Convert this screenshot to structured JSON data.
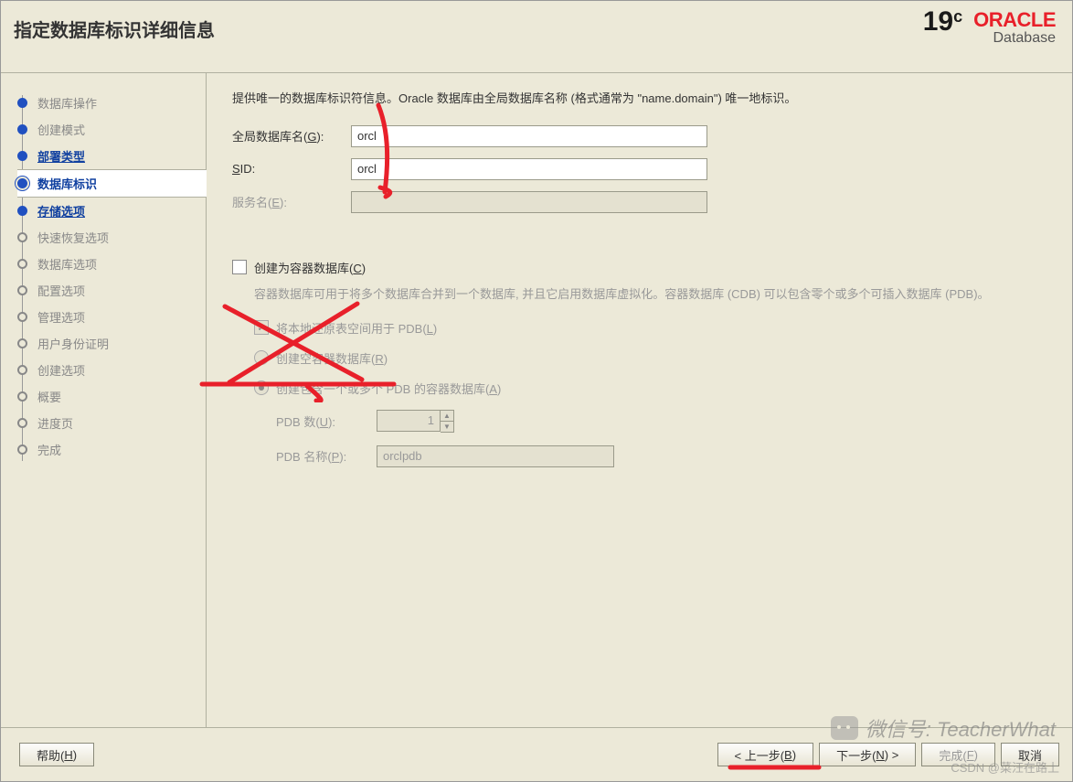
{
  "header": {
    "title": "指定数据库标识详细信息",
    "logo_version": "19",
    "logo_version_sup": "c",
    "logo_brand": "ORACLE",
    "logo_sub": "Database"
  },
  "sidebar": {
    "steps": [
      {
        "label": "数据库操作",
        "state": "done"
      },
      {
        "label": "创建模式",
        "state": "done"
      },
      {
        "label": "部署类型",
        "state": "link"
      },
      {
        "label": "数据库标识",
        "state": "active"
      },
      {
        "label": "存储选项",
        "state": "link"
      },
      {
        "label": "快速恢复选项",
        "state": "future"
      },
      {
        "label": "数据库选项",
        "state": "future"
      },
      {
        "label": "配置选项",
        "state": "future"
      },
      {
        "label": "管理选项",
        "state": "future"
      },
      {
        "label": "用户身份证明",
        "state": "future"
      },
      {
        "label": "创建选项",
        "state": "future"
      },
      {
        "label": "概要",
        "state": "future"
      },
      {
        "label": "进度页",
        "state": "future"
      },
      {
        "label": "完成",
        "state": "future"
      }
    ]
  },
  "content": {
    "intro": "提供唯一的数据库标识符信息。Oracle 数据库由全局数据库名称 (格式通常为 \"name.domain\") 唯一地标识。",
    "global_db_label_pre": "全局数据库名(",
    "global_db_key": "G",
    "global_db_label_post": "):",
    "global_db_value": "orcl",
    "sid_key": "S",
    "sid_label_post": "ID:",
    "sid_value": "orcl",
    "service_label_pre": "服务名(",
    "service_key": "E",
    "service_label_post": "):",
    "service_value": "",
    "cdb_check_pre": "创建为容器数据库(",
    "cdb_check_key": "C",
    "cdb_check_post": ")",
    "cdb_desc": "容器数据库可用于将多个数据库合并到一个数据库, 并且它启用数据库虚拟化。容器数据库 (CDB) 可以包含零个或多个可插入数据库 (PDB)。",
    "local_undo_pre": "将本地还原表空间用于 PDB(",
    "local_undo_key": "L",
    "local_undo_post": ")",
    "empty_cdb_pre": "创建空容器数据库(",
    "empty_cdb_key": "R",
    "empty_cdb_post": ")",
    "multi_pdb_pre": "创建包含一个或多个 PDB 的容器数据库(",
    "multi_pdb_key": "A",
    "multi_pdb_post": ")",
    "pdb_count_pre": "PDB 数(",
    "pdb_count_key": "U",
    "pdb_count_post": "):",
    "pdb_count_value": "1",
    "pdb_name_pre": "PDB 名称(",
    "pdb_name_key": "P",
    "pdb_name_post": "):",
    "pdb_name_value": "orclpdb"
  },
  "footer": {
    "help_pre": "帮助(",
    "help_key": "H",
    "help_post": ")",
    "back_pre": "< 上一步(",
    "back_key": "B",
    "back_post": ")",
    "next_pre": "下一步(",
    "next_key": "N",
    "next_post": ") >",
    "finish_pre": "完成(",
    "finish_key": "F",
    "finish_post": ")",
    "cancel": "取消"
  },
  "watermark": {
    "text": "微信号: TeacherWhat",
    "csdn": "CSDN @菜汪在路上"
  }
}
